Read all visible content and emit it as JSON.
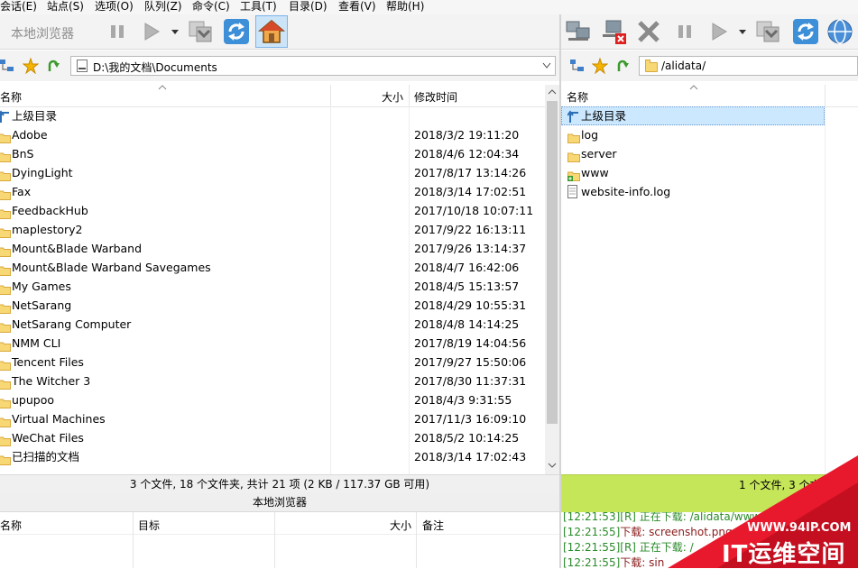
{
  "menu": [
    "会话(E)",
    "站点(S)",
    "选项(O)",
    "队列(Z)",
    "命令(C)",
    "工具(T)",
    "目录(D)",
    "查看(V)",
    "帮助(H)"
  ],
  "left_toolbar": {
    "browser_label": "本地浏览器"
  },
  "left_path": "D:\\我的文档\\Documents",
  "right_path": "/alidata/",
  "left_columns": {
    "name": "名称",
    "size": "大小",
    "modified": "修改时间"
  },
  "right_columns": {
    "name": "名称"
  },
  "left_rows": [
    {
      "name": "上级目录",
      "date": "",
      "icon": "up-arrow-icon"
    },
    {
      "name": "Adobe",
      "date": "2018/3/2 19:11:20",
      "icon": "folder-icon"
    },
    {
      "name": "BnS",
      "date": "2018/4/6 12:04:34",
      "icon": "folder-icon"
    },
    {
      "name": "DyingLight",
      "date": "2017/8/17 13:14:26",
      "icon": "folder-icon"
    },
    {
      "name": "Fax",
      "date": "2018/3/14 17:02:51",
      "icon": "folder-icon"
    },
    {
      "name": "FeedbackHub",
      "date": "2017/10/18 10:07:11",
      "icon": "folder-icon"
    },
    {
      "name": "maplestory2",
      "date": "2017/9/22 16:13:11",
      "icon": "folder-icon"
    },
    {
      "name": "Mount&Blade Warband",
      "date": "2017/9/26 13:14:37",
      "icon": "folder-icon"
    },
    {
      "name": "Mount&Blade Warband Savegames",
      "date": "2018/4/7 16:42:06",
      "icon": "folder-icon"
    },
    {
      "name": "My Games",
      "date": "2018/4/5 15:13:57",
      "icon": "folder-icon"
    },
    {
      "name": "NetSarang",
      "date": "2018/4/29 10:55:31",
      "icon": "folder-icon"
    },
    {
      "name": "NetSarang Computer",
      "date": "2018/4/8 14:14:25",
      "icon": "folder-icon"
    },
    {
      "name": "NMM CLI",
      "date": "2017/8/19 14:04:56",
      "icon": "folder-icon"
    },
    {
      "name": "Tencent Files",
      "date": "2017/9/27 15:50:06",
      "icon": "folder-icon"
    },
    {
      "name": "The Witcher 3",
      "date": "2017/8/30 11:37:31",
      "icon": "folder-icon"
    },
    {
      "name": "upupoo",
      "date": "2018/4/3 9:31:55",
      "icon": "folder-icon"
    },
    {
      "name": "Virtual Machines",
      "date": "2017/11/3 16:09:10",
      "icon": "folder-icon"
    },
    {
      "name": "WeChat Files",
      "date": "2018/5/2 10:14:25",
      "icon": "folder-icon"
    },
    {
      "name": "已扫描的文档",
      "date": "2018/3/14 17:02:43",
      "icon": "folder-icon"
    }
  ],
  "right_rows": [
    {
      "name": "上级目录",
      "icon": "up-arrow-icon"
    },
    {
      "name": "log",
      "icon": "folder-icon"
    },
    {
      "name": "server",
      "icon": "folder-icon"
    },
    {
      "name": "www",
      "icon": "folder-link-icon"
    },
    {
      "name": "website-info.log",
      "icon": "file-icon"
    }
  ],
  "left_status": "3 个文件, 18 个文件夹, 共计 21 项 (2 KB / 117.37 GB 可用)",
  "left_caption": "本地浏览器",
  "right_status": "1 个文件, 3 个文",
  "queue_columns": {
    "name": "名称",
    "target": "目标",
    "size": "大小",
    "note": "备注"
  },
  "log": [
    {
      "time": "[12:21:53]",
      "text": "[R] 正在下载: /alidata/www",
      "color": "#2a8a2a"
    },
    {
      "time": "[12:21:55]",
      "text": "下载: screenshot.png",
      "color": "#8a1a1a"
    },
    {
      "time": "[12:21:55]",
      "text": "[R] 正在下载: /",
      "color": "#2a8a2a"
    },
    {
      "time": "[12:21:55]",
      "text": "下载: sin",
      "color": "#8a1a1a"
    }
  ],
  "watermark": {
    "url": "WWW.94IP.COM",
    "brand": "IT运维空间"
  },
  "colors": {
    "selection": "#cce8ff",
    "right_status_bg": "#c6e65a",
    "watermark_red": "#e8192c"
  }
}
